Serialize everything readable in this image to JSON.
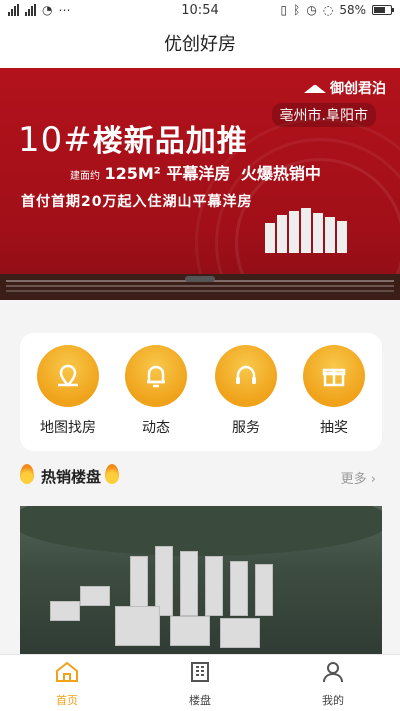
{
  "status_bar": {
    "time": "10:54",
    "battery": "58%"
  },
  "header": {
    "title": "优创好房"
  },
  "banner": {
    "brand": "御创君泊",
    "location": "亳州市.阜阳市",
    "headline_prefix": "10#",
    "headline": "楼新品加推",
    "sub_prefix": "建面约",
    "sub_area": "125M² 平幕洋房",
    "sub_hot": "火爆热销中",
    "sub_line2": "首付首期20万起入住湖山平幕洋房"
  },
  "quick_actions": [
    {
      "label": "地图找房",
      "icon": "map-pin-icon"
    },
    {
      "label": "动态",
      "icon": "bell-icon"
    },
    {
      "label": "服务",
      "icon": "headset-icon"
    },
    {
      "label": "抽奖",
      "icon": "gift-icon"
    }
  ],
  "section": {
    "title": "热销楼盘",
    "more": "更多"
  },
  "tabs": [
    {
      "label": "首页",
      "icon": "home-icon",
      "active": true
    },
    {
      "label": "楼盘",
      "icon": "building-icon",
      "active": false
    },
    {
      "label": "我的",
      "icon": "user-icon",
      "active": false
    }
  ],
  "colors": {
    "accent": "#f0a21a",
    "banner_red": "#b3121c"
  }
}
